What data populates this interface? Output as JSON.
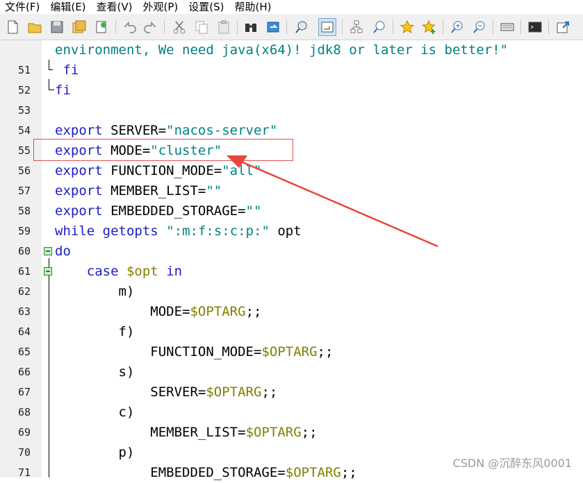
{
  "menubar": {
    "items": [
      "文件(F)",
      "编辑(E)",
      "查看(V)",
      "外观(P)",
      "设置(S)",
      "帮助(H)"
    ]
  },
  "toolbar": {
    "buttons": [
      "new-file",
      "open-folder",
      "save",
      "save-all",
      "print",
      "undo",
      "redo",
      "cut",
      "copy",
      "paste",
      "find",
      "replace",
      "zoom-find",
      "word-wrap",
      "tree",
      "zoom-search",
      "bookmark",
      "add-bookmark",
      "zoom-in",
      "zoom-out",
      "keyboard",
      "terminal",
      "pin"
    ]
  },
  "editor": {
    "lines": [
      {
        "num": "",
        "indent": 0,
        "parts": [
          {
            "t": "str",
            "v": "environment, We need java(x64)! jdk8 or later is better!\""
          }
        ]
      },
      {
        "num": "51",
        "indent": 1,
        "parts": [
          {
            "t": "kw",
            "v": "fi"
          }
        ]
      },
      {
        "num": "52",
        "indent": 0,
        "parts": [
          {
            "t": "kw",
            "v": "fi"
          }
        ]
      },
      {
        "num": "53",
        "indent": 0,
        "parts": []
      },
      {
        "num": "54",
        "indent": 0,
        "parts": [
          {
            "t": "kw",
            "v": "export"
          },
          {
            "t": "txt",
            "v": " SERVER="
          },
          {
            "t": "str",
            "v": "\"nacos-server\""
          }
        ]
      },
      {
        "num": "55",
        "indent": 0,
        "parts": [
          {
            "t": "kw",
            "v": "export"
          },
          {
            "t": "txt",
            "v": " MODE="
          },
          {
            "t": "str",
            "v": "\"cluster\""
          }
        ]
      },
      {
        "num": "56",
        "indent": 0,
        "parts": [
          {
            "t": "kw",
            "v": "export"
          },
          {
            "t": "txt",
            "v": " FUNCTION_MODE="
          },
          {
            "t": "str",
            "v": "\"all\""
          }
        ]
      },
      {
        "num": "57",
        "indent": 0,
        "parts": [
          {
            "t": "kw",
            "v": "export"
          },
          {
            "t": "txt",
            "v": " MEMBER_LIST="
          },
          {
            "t": "str",
            "v": "\"\""
          }
        ]
      },
      {
        "num": "58",
        "indent": 0,
        "parts": [
          {
            "t": "kw",
            "v": "export"
          },
          {
            "t": "txt",
            "v": " EMBEDDED_STORAGE="
          },
          {
            "t": "str",
            "v": "\"\""
          }
        ]
      },
      {
        "num": "59",
        "indent": 0,
        "parts": [
          {
            "t": "kw",
            "v": "while"
          },
          {
            "t": "txt",
            "v": " "
          },
          {
            "t": "kw",
            "v": "getopts"
          },
          {
            "t": "txt",
            "v": " "
          },
          {
            "t": "str",
            "v": "\":m:f:s:c:p:\""
          },
          {
            "t": "txt",
            "v": " opt"
          }
        ]
      },
      {
        "num": "60",
        "indent": 0,
        "parts": [
          {
            "t": "kw",
            "v": "do"
          }
        ]
      },
      {
        "num": "61",
        "indent": 4,
        "parts": [
          {
            "t": "kw",
            "v": "case"
          },
          {
            "t": "txt",
            "v": " "
          },
          {
            "t": "var",
            "v": "$opt"
          },
          {
            "t": "txt",
            "v": " "
          },
          {
            "t": "kw",
            "v": "in"
          }
        ]
      },
      {
        "num": "62",
        "indent": 8,
        "parts": [
          {
            "t": "txt",
            "v": "m)"
          }
        ]
      },
      {
        "num": "63",
        "indent": 12,
        "parts": [
          {
            "t": "txt",
            "v": "MODE="
          },
          {
            "t": "var",
            "v": "$OPTARG"
          },
          {
            "t": "txt",
            "v": ";;"
          }
        ]
      },
      {
        "num": "64",
        "indent": 8,
        "parts": [
          {
            "t": "txt",
            "v": "f)"
          }
        ]
      },
      {
        "num": "65",
        "indent": 12,
        "parts": [
          {
            "t": "txt",
            "v": "FUNCTION_MODE="
          },
          {
            "t": "var",
            "v": "$OPTARG"
          },
          {
            "t": "txt",
            "v": ";;"
          }
        ]
      },
      {
        "num": "66",
        "indent": 8,
        "parts": [
          {
            "t": "txt",
            "v": "s)"
          }
        ]
      },
      {
        "num": "67",
        "indent": 12,
        "parts": [
          {
            "t": "txt",
            "v": "SERVER="
          },
          {
            "t": "var",
            "v": "$OPTARG"
          },
          {
            "t": "txt",
            "v": ";;"
          }
        ]
      },
      {
        "num": "68",
        "indent": 8,
        "parts": [
          {
            "t": "txt",
            "v": "c)"
          }
        ]
      },
      {
        "num": "69",
        "indent": 12,
        "parts": [
          {
            "t": "txt",
            "v": "MEMBER_LIST="
          },
          {
            "t": "var",
            "v": "$OPTARG"
          },
          {
            "t": "txt",
            "v": ";;"
          }
        ]
      },
      {
        "num": "70",
        "indent": 8,
        "parts": [
          {
            "t": "txt",
            "v": "p)"
          }
        ]
      },
      {
        "num": "71",
        "indent": 12,
        "parts": [
          {
            "t": "txt",
            "v": "EMBEDDED_STORAGE="
          },
          {
            "t": "var",
            "v": "$OPTARG"
          },
          {
            "t": "txt",
            "v": ";;"
          }
        ]
      }
    ]
  },
  "watermark": "CSDN @沉醉东风0001",
  "colors": {
    "keyword": "#1c1cc8",
    "string": "#008080",
    "variable": "#808000",
    "annotation": "#e05050"
  }
}
